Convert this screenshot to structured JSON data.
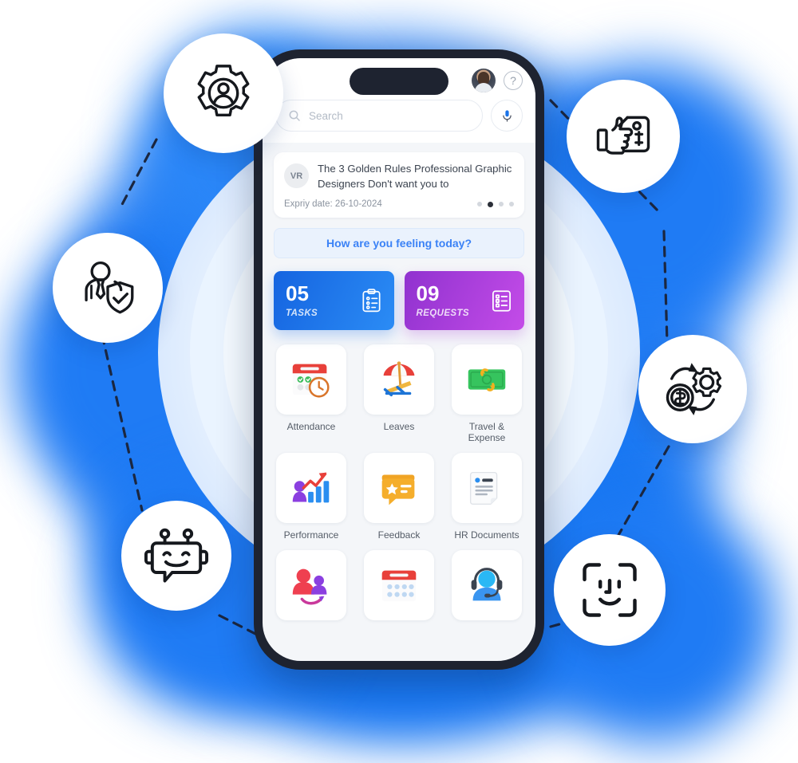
{
  "phone": {
    "header": {
      "avatar_name": "user-avatar",
      "help_label": "?",
      "search_placeholder": "Search",
      "search_value": "",
      "mic_label": "voice-search"
    },
    "news_card": {
      "badge": "VR",
      "title": "The 3 Golden Rules Professional Graphic Designers Don't want you to",
      "expiry": "Expriy date: 26-10-2024",
      "dots_total": 4,
      "active_dot": 2
    },
    "mood_banner": {
      "text": "How are you feeling today?"
    },
    "stats": [
      {
        "value": "05",
        "label": "TASKS",
        "icon": "clipboard-check-icon",
        "color": "#1564e0"
      },
      {
        "value": "09",
        "label": "REQUESTS",
        "icon": "list-box-icon",
        "color": "#9032cf"
      }
    ],
    "apps": [
      {
        "label": "Attendance",
        "icon": "calendar-clock-icon"
      },
      {
        "label": "Leaves",
        "icon": "beach-umbrella-icon"
      },
      {
        "label": "Travel & Expense",
        "icon": "money-exchange-icon"
      },
      {
        "label": "Performance",
        "icon": "growth-chart-icon"
      },
      {
        "label": "Feedback",
        "icon": "feedback-star-icon"
      },
      {
        "label": "HR Documents",
        "icon": "document-icon"
      },
      {
        "label": "",
        "icon": "people-swap-icon"
      },
      {
        "label": "",
        "icon": "calendar-dots-icon"
      },
      {
        "label": "",
        "icon": "support-headset-icon"
      }
    ]
  },
  "features": [
    {
      "name": "user-settings",
      "icon": "gear-user-icon"
    },
    {
      "name": "compensation",
      "icon": "thumbs-up-price-tag-icon"
    },
    {
      "name": "employee-protection",
      "icon": "employee-shield-icon"
    },
    {
      "name": "payroll-processing",
      "icon": "money-gear-cycle-icon"
    },
    {
      "name": "hr-chatbot",
      "icon": "robot-chat-icon"
    },
    {
      "name": "face-recognition",
      "icon": "face-id-icon"
    }
  ],
  "theme": {
    "glow_blue": "#1f7bf4",
    "phone_frame": "#1e2330",
    "accent_blue": "#3b82f6",
    "tasks_gradient_start": "#1564e0",
    "tasks_gradient_end": "#2b8cf5",
    "requests_gradient_start": "#9032cf",
    "requests_gradient_end": "#c44ce8",
    "connector_line": "#1b2740"
  }
}
